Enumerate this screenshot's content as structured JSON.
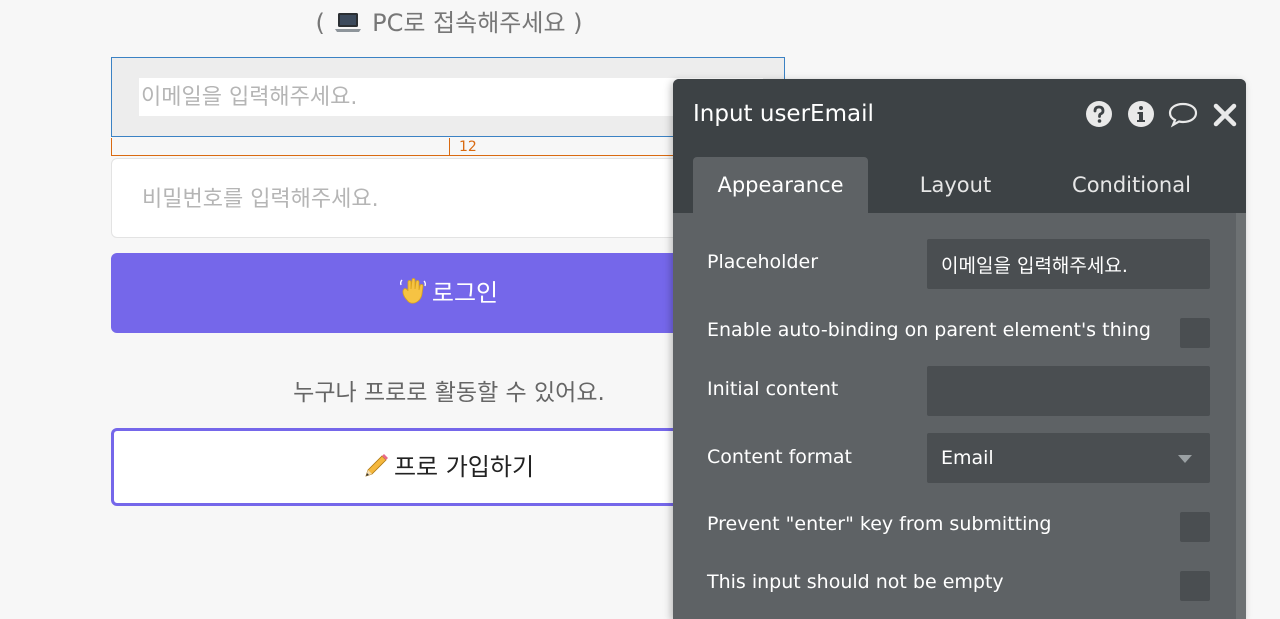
{
  "canvas": {
    "notice_open": "(",
    "notice_text": "PC로 접속해주세요",
    "notice_close": ")",
    "email_placeholder": "이메일을 입력해주세요.",
    "spacing_value": "12",
    "password_placeholder": "비밀번호를 입력해주세요.",
    "login_label": "로그인",
    "anyone_text": "누구나 프로로 활동할 수 있어요.",
    "signup_label": "프로 가입하기",
    "accent_color": "#7567ea"
  },
  "panel": {
    "title": "Input userEmail",
    "icons": [
      "help-icon",
      "info-icon",
      "comment-icon",
      "close-icon"
    ],
    "tabs": [
      "Appearance",
      "Layout",
      "Conditional"
    ],
    "active_tab": "Appearance",
    "rows": {
      "placeholder_label": "Placeholder",
      "placeholder_value": "이메일을 입력해주세요.",
      "auto_binding_label": "Enable auto-binding on parent element's thing",
      "initial_content_label": "Initial content",
      "initial_content_value": "",
      "content_format_label": "Content format",
      "content_format_value": "Email",
      "prevent_enter_label": "Prevent \"enter\" key from submitting",
      "not_empty_label": "This input should not be empty"
    }
  }
}
